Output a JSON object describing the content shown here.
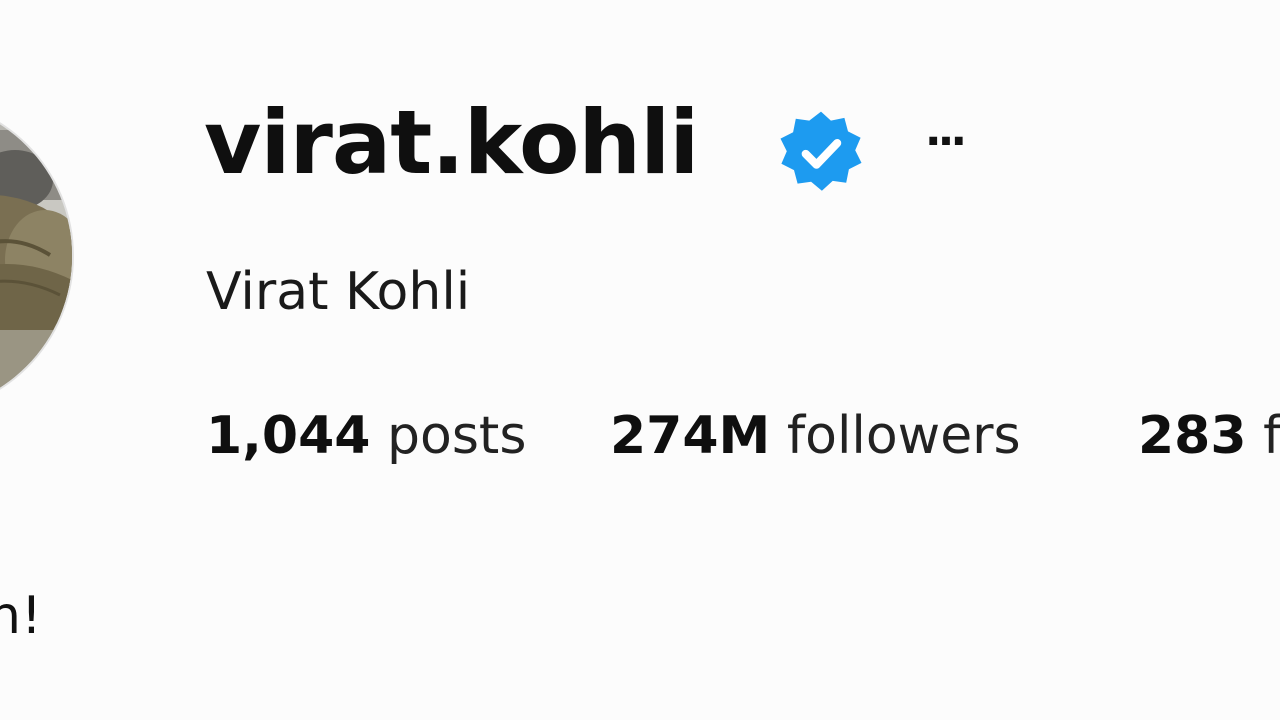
{
  "profile": {
    "username": "virat.kohli",
    "full_name": "Virat Kohli",
    "verified_icon": "verified-badge-icon",
    "more_icon": "more-options-icon",
    "more_label": "···",
    "stats": {
      "posts_count": "1,044",
      "posts_label": "posts",
      "followers_count": "274M",
      "followers_label": "followers",
      "following_count": "283",
      "following_label": "f"
    },
    "bio_fragment": "n!"
  },
  "colors": {
    "verified_blue": "#1d9bf0",
    "text": "#111111",
    "background": "#fcfcfc"
  }
}
